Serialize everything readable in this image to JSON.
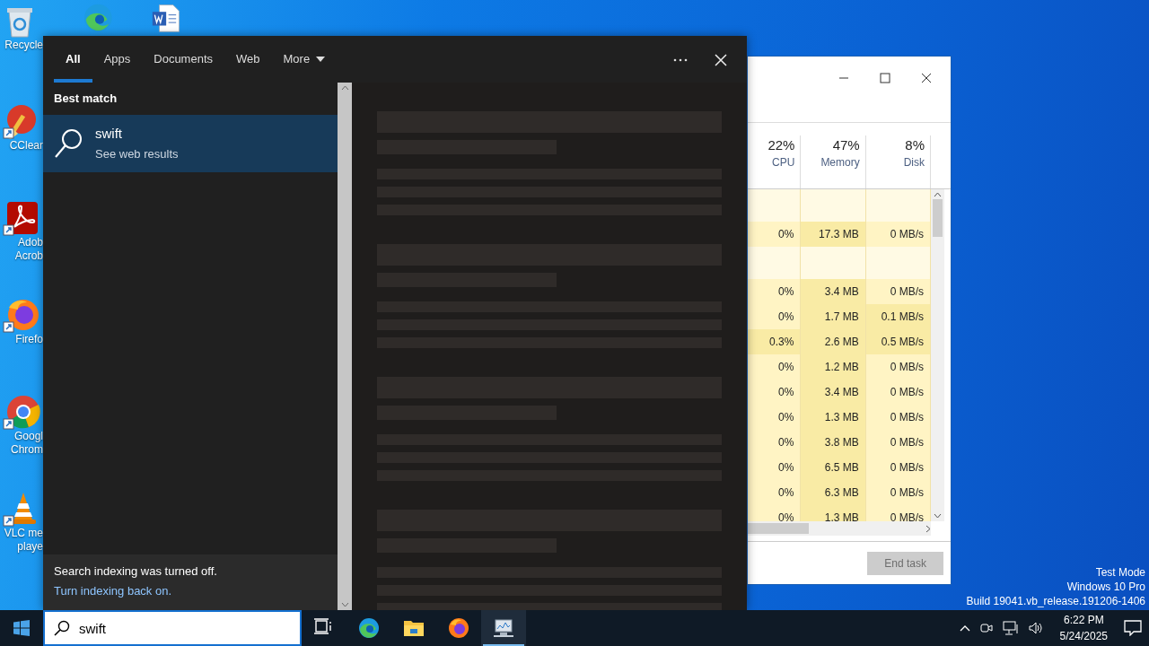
{
  "desktop": {
    "top_row_icons": [
      {
        "kind": "recycle",
        "lines": [
          "Recycle"
        ]
      },
      {
        "kind": "edge"
      },
      {
        "kind": "word"
      }
    ],
    "column_icons": [
      {
        "kind": "ccleaner",
        "lines": [
          "CClear"
        ]
      },
      {
        "kind": "acrobat",
        "lines": [
          "Adob",
          "Acrob"
        ]
      },
      {
        "kind": "firefox",
        "lines": [
          "Firefo"
        ]
      },
      {
        "kind": "chrome",
        "lines": [
          "Googl",
          "Chrom"
        ]
      },
      {
        "kind": "vlc",
        "lines": [
          "VLC me",
          "playe"
        ]
      }
    ]
  },
  "task_manager": {
    "columns": [
      {
        "percent": "22%",
        "label": "CPU"
      },
      {
        "percent": "47%",
        "label": "Memory"
      },
      {
        "percent": "8%",
        "label": "Disk"
      }
    ],
    "rows": [
      {
        "kind": "group"
      },
      {
        "kind": "process",
        "cpu": "0%",
        "memory": "17.3 MB",
        "disk": "0 MB/s"
      },
      {
        "kind": "group"
      },
      {
        "kind": "process",
        "cpu": "0%",
        "memory": "3.4 MB",
        "disk": "0 MB/s"
      },
      {
        "kind": "process",
        "cpu": "0%",
        "memory": "1.7 MB",
        "disk": "0.1 MB/s"
      },
      {
        "kind": "process",
        "cpu": "0.3%",
        "memory": "2.6 MB",
        "disk": "0.5 MB/s"
      },
      {
        "kind": "process",
        "cpu": "0%",
        "memory": "1.2 MB",
        "disk": "0 MB/s"
      },
      {
        "kind": "process",
        "cpu": "0%",
        "memory": "3.4 MB",
        "disk": "0 MB/s"
      },
      {
        "kind": "process",
        "cpu": "0%",
        "memory": "1.3 MB",
        "disk": "0 MB/s"
      },
      {
        "kind": "process",
        "cpu": "0%",
        "memory": "3.8 MB",
        "disk": "0 MB/s"
      },
      {
        "kind": "process",
        "cpu": "0%",
        "memory": "6.5 MB",
        "disk": "0 MB/s"
      },
      {
        "kind": "process",
        "cpu": "0%",
        "memory": "6.3 MB",
        "disk": "0 MB/s"
      },
      {
        "kind": "process",
        "cpu": "0%",
        "memory": "1.3 MB",
        "disk": "0 MB/s"
      }
    ],
    "end_task": {
      "label": "End task",
      "disabled": true
    }
  },
  "search": {
    "tabs": [
      {
        "label": "All",
        "selected": true,
        "kind": "tab"
      },
      {
        "label": "Apps",
        "selected": false,
        "kind": "tab"
      },
      {
        "label": "Documents",
        "selected": false,
        "kind": "tab"
      },
      {
        "label": "Web",
        "selected": false,
        "kind": "tab"
      },
      {
        "label": "More",
        "selected": false,
        "kind": "menu"
      }
    ],
    "heading": "Best match",
    "result": {
      "title": "swift",
      "subtitle": "See web results",
      "selected": true
    },
    "footer": {
      "message": "Search indexing was turned off.",
      "link": "Turn indexing back on."
    },
    "preview": {
      "loading": true
    }
  },
  "taskbar": {
    "search_field": {
      "value": "swift"
    },
    "apps": [
      {
        "kind": "task-view",
        "active": false
      },
      {
        "kind": "edge",
        "active": false
      },
      {
        "kind": "explorer",
        "active": false
      },
      {
        "kind": "firefox",
        "active": false
      },
      {
        "kind": "task-manager",
        "active": true
      }
    ],
    "time": "6:22 PM",
    "date": "5/24/2025"
  },
  "system_watermark": [
    "Test Mode",
    "Windows 10 Pro",
    "Build 19041.vb_release.191206-1406"
  ]
}
